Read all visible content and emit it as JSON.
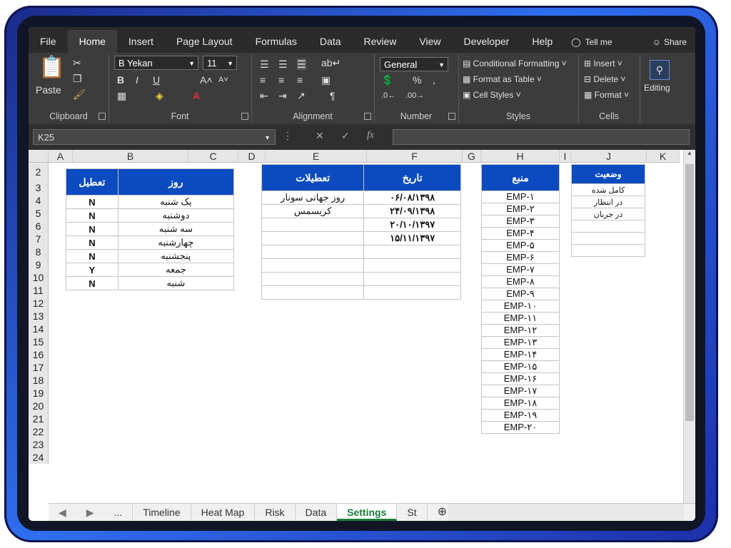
{
  "ribbon_tabs": [
    "File",
    "Home",
    "Insert",
    "Page Layout",
    "Formulas",
    "Data",
    "Review",
    "View",
    "Developer",
    "Help"
  ],
  "tell_me": "Tell me",
  "share": "Share",
  "clipboard": {
    "paste": "Paste",
    "label": "Clipboard"
  },
  "font": {
    "name": "B Yekan",
    "size": "11",
    "label": "Font"
  },
  "alignment": {
    "label": "Alignment"
  },
  "number": {
    "format": "General",
    "label": "Number",
    "percent": "%",
    "comma": ","
  },
  "styles": {
    "conditional": "Conditional Formatting",
    "table": "Format as Table",
    "cell": "Cell Styles",
    "label": "Styles"
  },
  "cells": {
    "insert": "Insert",
    "delete": "Delete",
    "format": "Format",
    "label": "Cells"
  },
  "editing": {
    "label": "Editing"
  },
  "formula_bar": {
    "name_box": "K25",
    "fx": "fx"
  },
  "columns": [
    "A",
    "B",
    "C",
    "D",
    "E",
    "F",
    "G",
    "H",
    "I",
    "J",
    "K"
  ],
  "rows": [
    "2",
    "3",
    "4",
    "5",
    "6",
    "7",
    "8",
    "9",
    "10",
    "11",
    "12",
    "13",
    "14",
    "15",
    "16",
    "17",
    "18",
    "19",
    "20",
    "21",
    "22",
    "23",
    "24"
  ],
  "table_days": {
    "headers": [
      "روز",
      "تعطیل"
    ],
    "rows": [
      [
        "یک شنبه",
        "N"
      ],
      [
        "دوشنبه",
        "N"
      ],
      [
        "سه شنبه",
        "N"
      ],
      [
        "چهارشنبه",
        "N"
      ],
      [
        "پنجشنبه",
        "N"
      ],
      [
        "جمعه",
        "Y"
      ],
      [
        "شنبه",
        "N"
      ]
    ]
  },
  "table_holidays": {
    "headers": [
      "تعطیلات",
      "تاریخ"
    ],
    "rows": [
      [
        "روز جهانی سونار",
        "۰۶/۰۸/۱۳۹۸"
      ],
      [
        "کریسمس",
        "۲۴/۰۹/۱۳۹۸"
      ],
      [
        "",
        "۲۰/۱۰/۱۳۹۷"
      ],
      [
        "",
        "۱۵/۱۱/۱۳۹۷"
      ],
      [
        "",
        ""
      ],
      [
        "",
        ""
      ],
      [
        "",
        ""
      ],
      [
        "",
        ""
      ]
    ]
  },
  "table_resources": {
    "header": "منبع",
    "rows": [
      "EMP-۱",
      "EMP-۲",
      "EMP-۳",
      "EMP-۴",
      "EMP-۵",
      "EMP-۶",
      "EMP-۷",
      "EMP-۸",
      "EMP-۹",
      "EMP-۱۰",
      "EMP-۱۱",
      "EMP-۱۲",
      "EMP-۱۳",
      "EMP-۱۴",
      "EMP-۱۵",
      "EMP-۱۶",
      "EMP-۱۷",
      "EMP-۱۸",
      "EMP-۱۹",
      "EMP-۲۰"
    ]
  },
  "table_status": {
    "header": "وضعیت",
    "rows": [
      "کامل شده",
      "در انتظار",
      "در جریان",
      "",
      "",
      ""
    ]
  },
  "sheet_tabs": [
    "Timeline",
    "Heat Map",
    "Risk",
    "Data",
    "Settings",
    "St"
  ],
  "active_sheet": "Settings",
  "nav": {
    "more": "..."
  }
}
